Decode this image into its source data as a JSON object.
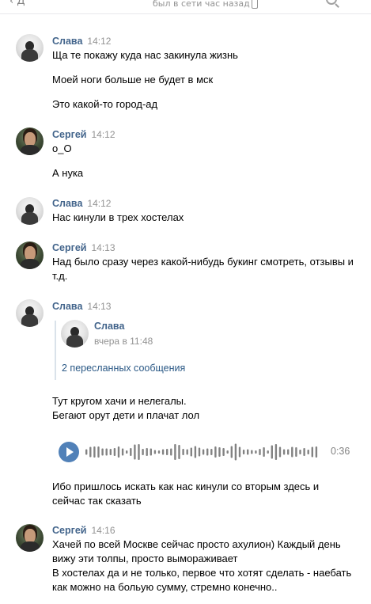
{
  "header": {
    "back_label": "‹ Д",
    "status": "был в сети час назад",
    "phone_icon": "phone-icon",
    "search_icon": "search-icon"
  },
  "messages": [
    {
      "name": "Слава",
      "time": "14:12",
      "avatar": "slava",
      "lines": [
        "Ща те покажу куда нас закинула жизнь",
        "Моей ноги больше не будет в мск",
        "Это какой-то город-ад"
      ]
    },
    {
      "name": "Сергей",
      "time": "14:12",
      "avatar": "sergey",
      "lines": [
        "о_О",
        "А нука"
      ]
    },
    {
      "name": "Слава",
      "time": "14:12",
      "avatar": "slava",
      "lines": [
        "Нас кинули в трех хостелах"
      ]
    },
    {
      "name": "Сергей",
      "time": "14:13",
      "avatar": "sergey",
      "lines": [
        "Над было сразу через какой-нибудь букинг смотреть, отзывы и т.д."
      ]
    },
    {
      "name": "Слава",
      "time": "14:13",
      "avatar": "slava",
      "forward": {
        "name": "Слава",
        "time": "вчера в 11:48",
        "link": "2 пересланных сообщения"
      },
      "lines": [
        "Тут кругом хачи и нелегалы.",
        "Бегают орут дети и плачат лол",
        "Ибо пришлось искать как нас кинули со вторым здесь и сейчас так сказать"
      ],
      "voice": {
        "duration": "0:36"
      }
    },
    {
      "name": "Сергей",
      "time": "14:16",
      "avatar": "sergey",
      "lines": [
        "Хачей по всей Москве сейчас просто ахулион) Каждый день вижу эти толпы, просто вымораживает",
        "В хостелах да и не только, первое что хотят сделать - наебать как можно на больую сумму, стремно конечно.."
      ]
    }
  ],
  "colors": {
    "name": "#42648b",
    "time": "#939393",
    "link": "#2a5885",
    "accent": "#5181b8",
    "wave": "#828282"
  }
}
